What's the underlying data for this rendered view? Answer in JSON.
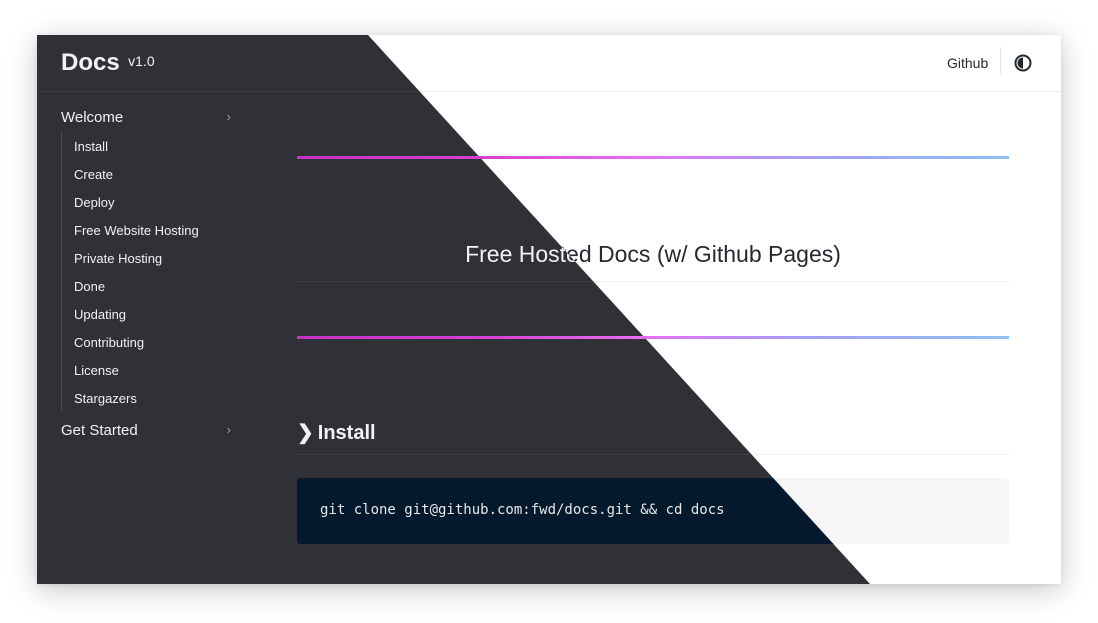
{
  "header": {
    "logo_title": "Docs",
    "logo_version": "v1.0",
    "github_label": "Github",
    "theme_toggle_icon": "half-circle-contrast-icon"
  },
  "sidebar": {
    "sections": [
      {
        "label": "Welcome",
        "items": [
          {
            "label": "Install"
          },
          {
            "label": "Create"
          },
          {
            "label": "Deploy"
          },
          {
            "label": "Free Website Hosting"
          },
          {
            "label": "Private Hosting"
          },
          {
            "label": "Done"
          },
          {
            "label": "Updating"
          },
          {
            "label": "Contributing"
          },
          {
            "label": "License"
          },
          {
            "label": "Stargazers"
          }
        ]
      },
      {
        "label": "Get Started",
        "items": []
      }
    ]
  },
  "main": {
    "page_title": "Free Hosted Docs (w/ Github Pages)",
    "section_title": "Install",
    "code": "git clone git@github.com:fwd/docs.git && cd docs"
  },
  "colors": {
    "dark_background": "#2f3136",
    "code_dark_background": "#04192b",
    "gradient_start": "#c433c8",
    "gradient_mid": "#e86ef0",
    "gradient_end": "#8ec0ef"
  }
}
